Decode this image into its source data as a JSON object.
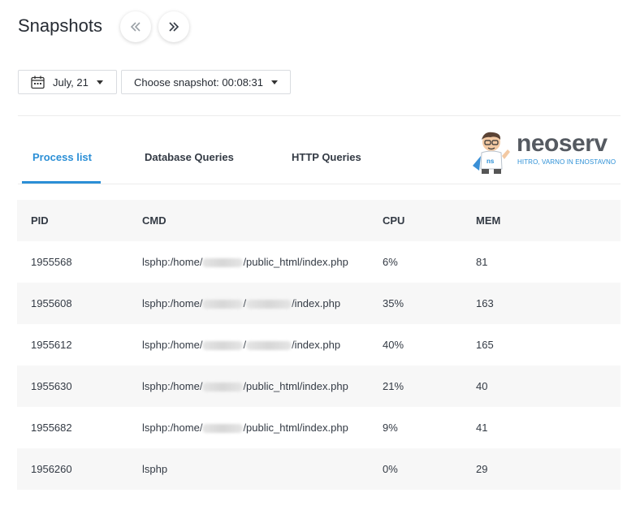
{
  "header": {
    "title": "Snapshots",
    "prev_icon": "double-chevron-left-icon",
    "next_icon": "double-chevron-right-icon"
  },
  "controls": {
    "date_label": "July, 21",
    "snapshot_label": "Choose snapshot: 00:08:31"
  },
  "tabs": [
    {
      "label": "Process list",
      "active": true
    },
    {
      "label": "Database Queries",
      "active": false
    },
    {
      "label": "HTTP Queries",
      "active": false
    }
  ],
  "logo": {
    "word": "neoserv",
    "tagline": "HITRO, VARNO IN ENOSTAVNO",
    "badge": "ns"
  },
  "table": {
    "columns": [
      "PID",
      "CMD",
      "CPU",
      "MEM"
    ],
    "rows": [
      {
        "pid": "1955568",
        "cmd_prefix": "lsphp:/home/",
        "cmd_mid": "",
        "cmd_suffix": "/public_html/index.php",
        "cpu": "6%",
        "mem": "81"
      },
      {
        "pid": "1955608",
        "cmd_prefix": "lsphp:/home/",
        "cmd_mid": "/",
        "cmd_suffix": "/index.php",
        "cpu": "35%",
        "mem": "163"
      },
      {
        "pid": "1955612",
        "cmd_prefix": "lsphp:/home/",
        "cmd_mid": "/",
        "cmd_suffix": "/index.php",
        "cpu": "40%",
        "mem": "165"
      },
      {
        "pid": "1955630",
        "cmd_prefix": "lsphp:/home/",
        "cmd_mid": "",
        "cmd_suffix": "/public_html/index.php",
        "cpu": "21%",
        "mem": "40"
      },
      {
        "pid": "1955682",
        "cmd_prefix": "lsphp:/home/",
        "cmd_mid": "",
        "cmd_suffix": "/public_html/index.php",
        "cpu": "9%",
        "mem": "41"
      },
      {
        "pid": "1956260",
        "cmd_prefix": "lsphp",
        "cmd_mid": "",
        "cmd_suffix": "",
        "cpu": "0%",
        "mem": "29"
      }
    ]
  },
  "colors": {
    "accent": "#2b8fd6",
    "row_alt": "#f7f7f7",
    "logo_text": "#555a61"
  }
}
